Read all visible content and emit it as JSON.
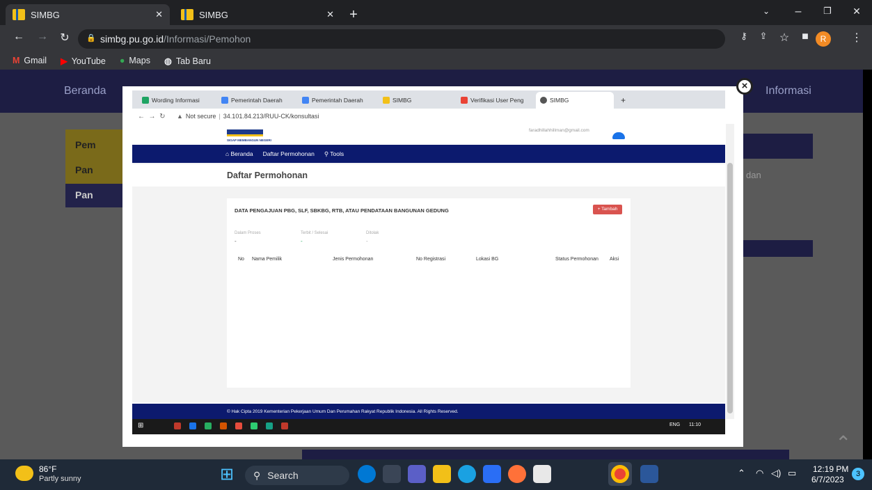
{
  "browser": {
    "tabs": [
      {
        "title": "SIMBG"
      },
      {
        "title": "SIMBG"
      }
    ],
    "new_tab": "+",
    "url_host": "simbg.pu.go.id",
    "url_path": "/Informasi/Pemohon",
    "profile_initial": "R",
    "bookmarks": [
      "Gmail",
      "YouTube",
      "Maps",
      "Tab Baru"
    ]
  },
  "background_page": {
    "nav_home": "Beranda",
    "nav_info": "Informasi",
    "side_items": [
      "Pem",
      "Pan",
      "Pan"
    ],
    "side_text_right": "dan"
  },
  "popup": {
    "close": "×",
    "inner_tabs": [
      "Wording Informasi",
      "Pemerintah Daerah",
      "Pemerintah Daerah",
      "SIMBG",
      "Verifikasi User Peng",
      "SIMBG"
    ],
    "inner_new_tab": "+",
    "not_secure": "Not secure",
    "inner_url": "34.101.84.213/RUU-CK/konsultasi",
    "logo_sub": "SIGAP MEMBANGUN NEGERI",
    "user_email": "faradhillahhillman@gmail.com",
    "nav": [
      "Beranda",
      "Daftar Permohonan",
      "Tools"
    ],
    "page_title": "Daftar Permohonan",
    "card_title": "DATA PENGAJUAN PBG, SLF, SBKBG, RTB, ATAU PENDATAAN BANGUNAN GEDUNG",
    "add_button": "+ Tambah",
    "status_filters": [
      {
        "label": "Dalam Proses",
        "value": "-"
      },
      {
        "label": "Terbit / Selesai",
        "value": "-"
      },
      {
        "label": "Ditolak",
        "value": "-"
      }
    ],
    "columns": [
      "No",
      "Nama Pemilik",
      "Jenis Permohonan",
      "No Registrasi",
      "Lokasi BG",
      "Status Permohonan",
      "Aksi"
    ],
    "footer": "© Hak Cipta 2019 Kementerian Pekerjaan Umum Dan Perumahan Rakyat Republik Indonesia. All Rights Reserved.",
    "inner_time": "11:10",
    "inner_lang": "ENG"
  },
  "taskbar": {
    "temp": "86°F",
    "weather": "Partly sunny",
    "search": "Search",
    "time": "12:19 PM",
    "date": "6/7/2023",
    "notif_count": "3"
  },
  "colors": {
    "nav_blue": "#0c1a6e",
    "add_red": "#d9534f",
    "bg_nav": "#1d1d43"
  }
}
